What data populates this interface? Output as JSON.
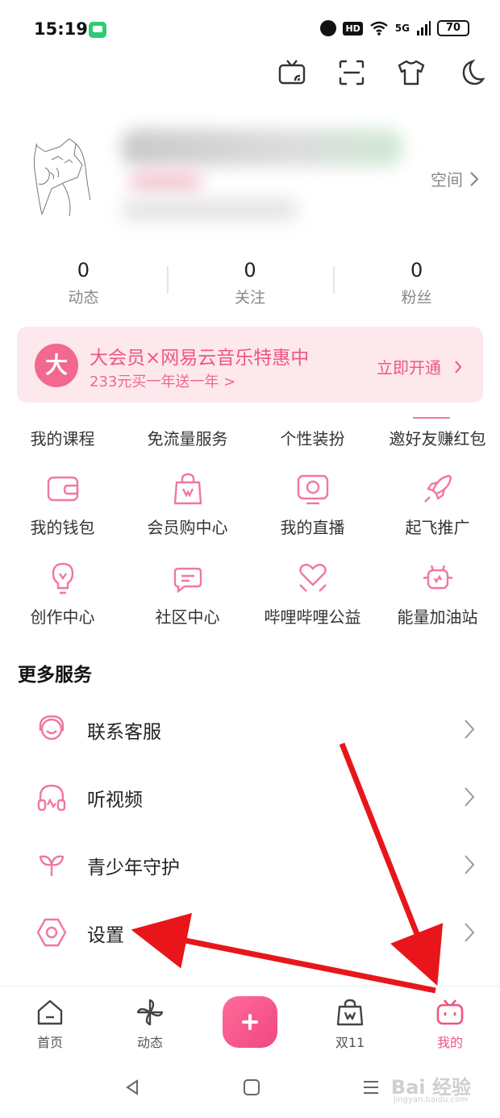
{
  "status": {
    "time": "15:19",
    "hd": "HD",
    "network": "5G",
    "battery": "70"
  },
  "top_icons": [
    "tv-cast-icon",
    "scan-icon",
    "shirt-icon",
    "moon-icon"
  ],
  "profile": {
    "space_label": "空间"
  },
  "stats": [
    {
      "value": "0",
      "label": "动态"
    },
    {
      "value": "0",
      "label": "关注"
    },
    {
      "value": "0",
      "label": "粉丝"
    }
  ],
  "vip": {
    "badge": "大",
    "title": "大会员×网易云音乐特惠中",
    "subtitle": "233元买一年送一年 >",
    "action": "立即开通"
  },
  "quick_links": [
    "我的课程",
    "免流量服务",
    "个性装扮",
    "邀好友赚红包"
  ],
  "grid_row1": [
    {
      "label": "我的钱包",
      "icon": "wallet-icon"
    },
    {
      "label": "会员购中心",
      "icon": "shopping-bag-icon"
    },
    {
      "label": "我的直播",
      "icon": "live-tv-icon"
    },
    {
      "label": "起飞推广",
      "icon": "rocket-icon"
    }
  ],
  "grid_row2": [
    {
      "label": "创作中心",
      "icon": "lightbulb-icon"
    },
    {
      "label": "社区中心",
      "icon": "chat-icon"
    },
    {
      "label": "哔哩哔哩公益",
      "icon": "heart-hands-icon"
    },
    {
      "label": "能量加油站",
      "icon": "energy-icon"
    }
  ],
  "more_services": {
    "title": "更多服务",
    "items": [
      {
        "label": "联系客服",
        "icon": "headset-service-icon"
      },
      {
        "label": "听视频",
        "icon": "headphones-icon"
      },
      {
        "label": "青少年守护",
        "icon": "sprout-icon"
      },
      {
        "label": "设置",
        "icon": "settings-hexagon-icon"
      }
    ]
  },
  "bottom_nav": [
    {
      "label": "首页",
      "icon": "home-icon"
    },
    {
      "label": "动态",
      "icon": "pinwheel-icon"
    },
    {
      "label": "双11",
      "icon": "shopping-bag-icon"
    },
    {
      "label": "我的",
      "icon": "tv-face-icon"
    }
  ],
  "colors": {
    "accent": "#f0567f",
    "banner_bg": "#fde8ee",
    "icon_pink": "#f0789c",
    "arrow_red": "#e8161b"
  },
  "watermark": {
    "main": "Bai 经验",
    "sub": "jingyan.baidu.com"
  }
}
